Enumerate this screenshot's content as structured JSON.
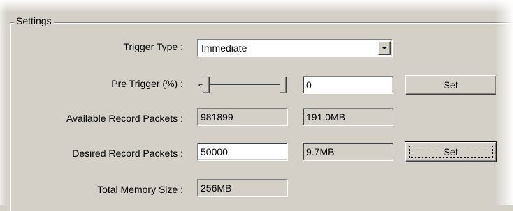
{
  "group": {
    "title": "Settings"
  },
  "trigger_type": {
    "label": "Trigger Type :",
    "value": "Immediate",
    "icon": "chevron-down-icon"
  },
  "pre_trigger": {
    "label": "Pre Trigger (%) :",
    "value": "0",
    "set_label": "Set"
  },
  "available_record_packets": {
    "label": "Available Record Packets :",
    "packets": "981899",
    "size": "191.0MB"
  },
  "desired_record_packets": {
    "label": "Desired Record Packets :",
    "value": "50000",
    "size": "9.7MB",
    "set_label": "Set"
  },
  "total_memory_size": {
    "label": "Total Memory Size :",
    "value": "256MB"
  },
  "colors": {
    "face": "#d4d0c8",
    "edit_bg": "#ffffff",
    "shadow": "#808080",
    "dark_shadow": "#404040",
    "highlight": "#ffffff"
  }
}
